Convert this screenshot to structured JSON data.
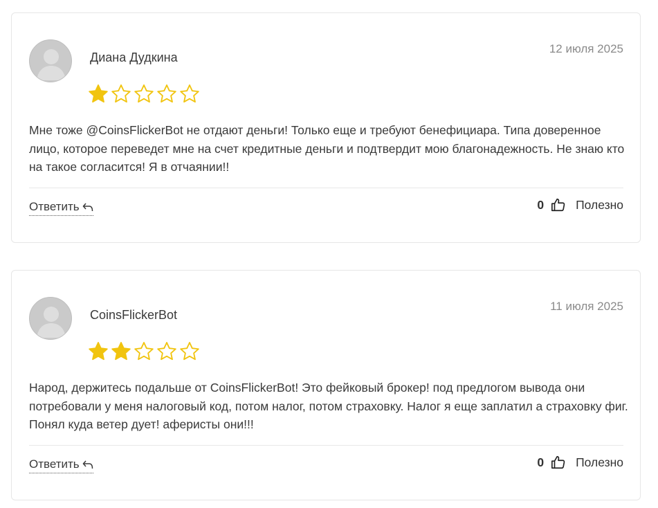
{
  "colors": {
    "star_filled": "#f1c40f",
    "star_empty_outline": "#f1c40f",
    "text": "#3a3a3a",
    "date": "#8a8a8a",
    "border": "#e6e6e6"
  },
  "reviews": [
    {
      "author": "Диана Дудкина",
      "date": "12 июля 2025",
      "rating": 1,
      "max_rating": 5,
      "text": "Мне тоже @CoinsFlickerBot не отдают деньги! Только еще и требуют бенефициара. Типа доверенное лицо, которое переведет мне на счет кредитные деньги и подтвердит мою благонадежность. Не знаю кто на такое согласится! Я в отчаянии!!",
      "reply_label": "Ответить",
      "helpful_count": "0",
      "helpful_label": "Полезно",
      "icons": {
        "avatar": "user-avatar-placeholder",
        "reply": "reply-arrow-icon",
        "helpful": "thumbs-up-icon"
      }
    },
    {
      "author": "CoinsFlickerBot",
      "date": "11 июля 2025",
      "rating": 2,
      "max_rating": 5,
      "text": "Народ, держитесь подальше от CoinsFlickerBot! Это фейковый брокер! под предлогом вывода они потребовали у меня налоговый код, потом налог, потом страховку. Налог я еще заплатил а страховку фиг. Понял куда ветер дует! аферисты они!!!",
      "reply_label": "Ответить",
      "helpful_count": "0",
      "helpful_label": "Полезно",
      "icons": {
        "avatar": "user-avatar-placeholder",
        "reply": "reply-arrow-icon",
        "helpful": "thumbs-up-icon"
      }
    }
  ]
}
